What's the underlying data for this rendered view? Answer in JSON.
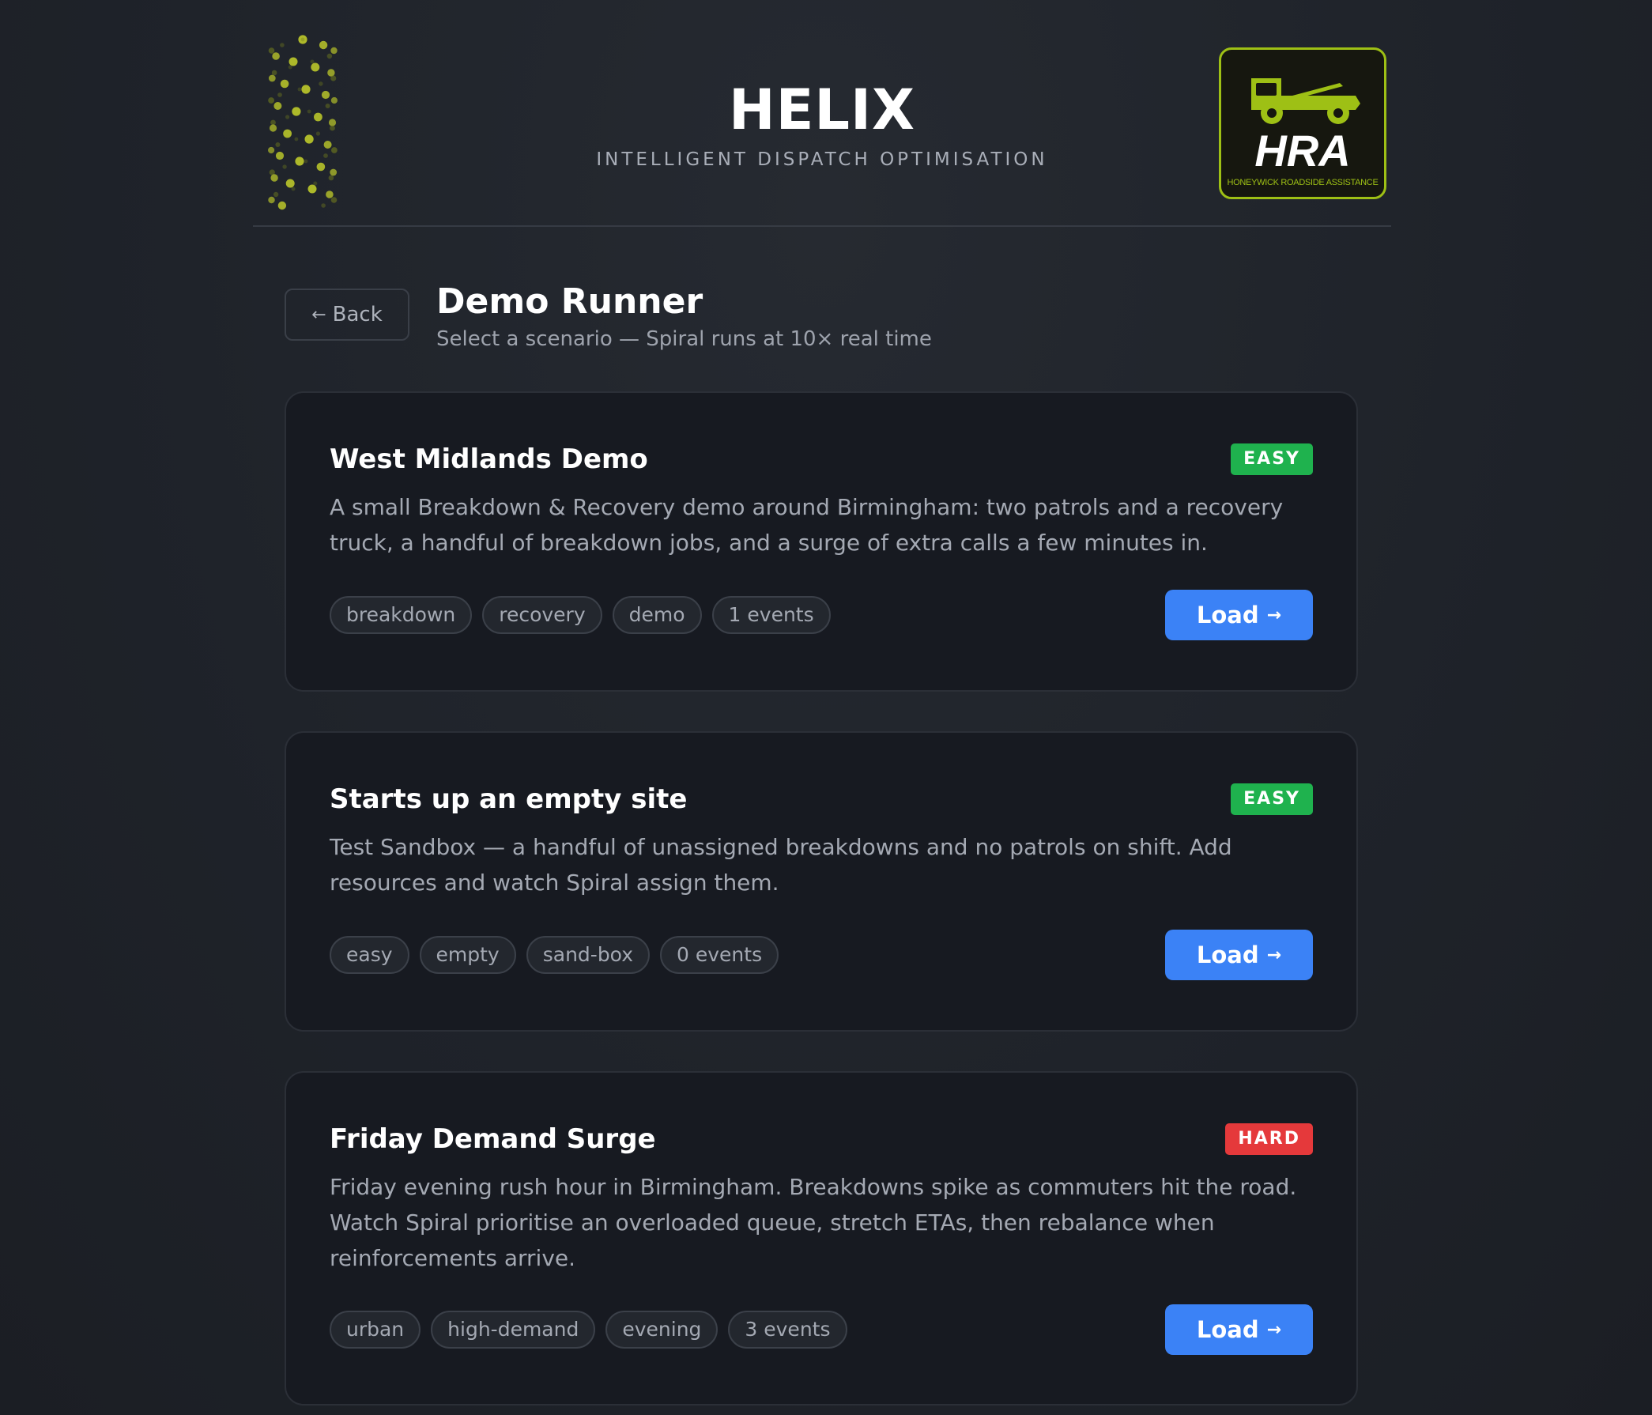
{
  "header": {
    "brand_title": "HELIX",
    "brand_subtitle": "INTELLIGENT DISPATCH OPTIMISATION",
    "logo_text": "HRA",
    "logo_caption": "HONEYWICK ROADSIDE ASSISTANCE",
    "helix_icon": "helix-icon",
    "logo_icon": "tow-truck-icon"
  },
  "page": {
    "back_label": "Back",
    "back_icon": "←",
    "title": "Demo Runner",
    "subtitle": "Select a scenario — Spiral runs at 10× real time"
  },
  "load_label": "Load",
  "load_icon": "→",
  "colors": {
    "accent": "#3b82f6",
    "easy": "#1fb24e",
    "hard": "#e5393b",
    "logo_green": "#9ec015"
  },
  "scenarios": [
    {
      "title": "West Midlands Demo",
      "difficulty": "EASY",
      "description": "A small Breakdown & Recovery demo around Birmingham: two patrols and a recovery truck, a handful of breakdown jobs, and a surge of extra calls a few minutes in.",
      "tags": [
        "breakdown",
        "recovery",
        "demo",
        "1 events"
      ]
    },
    {
      "title": "Starts up an empty site",
      "difficulty": "EASY",
      "description": "Test Sandbox — a handful of unassigned breakdowns and no patrols on shift. Add resources and watch Spiral assign them.",
      "tags": [
        "easy",
        "empty",
        "sand-box",
        "0 events"
      ]
    },
    {
      "title": "Friday Demand Surge",
      "difficulty": "HARD",
      "description": "Friday evening rush hour in Birmingham. Breakdowns spike as commuters hit the road. Watch Spiral prioritise an overloaded queue, stretch ETAs, then rebalance when reinforcements arrive.",
      "tags": [
        "urban",
        "high-demand",
        "evening",
        "3 events"
      ]
    }
  ]
}
